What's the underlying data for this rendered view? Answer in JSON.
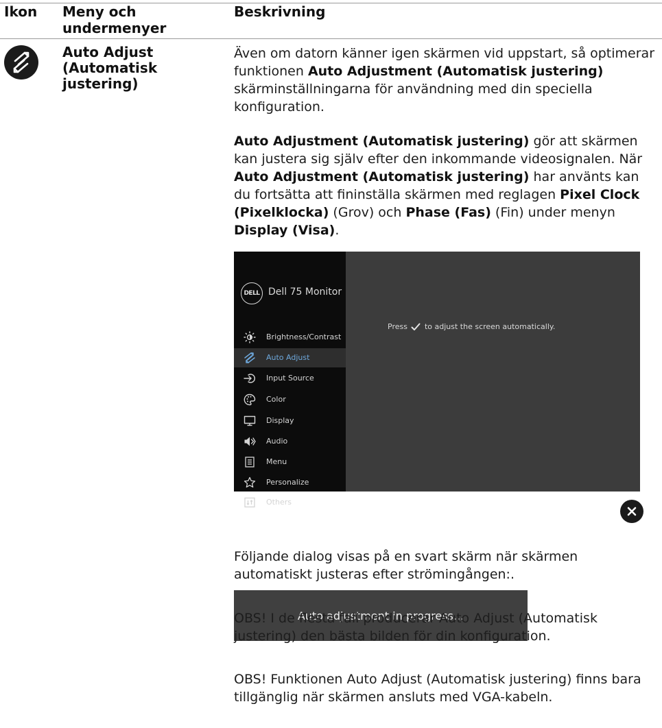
{
  "table": {
    "headers": {
      "icon": "Ikon",
      "menu": "Meny och undermenyer",
      "description": "Beskrivning"
    },
    "row": {
      "icon_name": "auto-adjust-icon",
      "menu_title": "Auto Adjust (Automatisk justering)",
      "paragraph1": {
        "pre": "Även om datorn känner igen skärmen vid uppstart, så optimerar funktionen ",
        "bold": "Auto Adjustment (Automatisk justering)",
        "post": " skärminställningarna för användning med din speciella konfiguration."
      },
      "paragraph2": {
        "b1": "Auto Adjustment (Automatisk justering)",
        "t1": " gör att skärmen kan justera sig själv efter den inkommande videosignalen. När ",
        "b2": "Auto Adjustment (Automatisk justering)",
        "t2": " har använts kan du fortsätta att fininställa skärmen med reglagen ",
        "b3": "Pixel Clock (Pixelklocka)",
        "t3": " (Grov) och ",
        "b4": "Phase (Fas)",
        "t4": " (Fin) under menyn ",
        "b5": "Display (Visa)",
        "t5": "."
      },
      "paragraph3": "Följande dialog visas på en svart skärm när skärmen automatiskt justeras efter strömingången:.",
      "note1": "OBS! I de flesta fall producerar Auto Adjust (Automatisk justering) den bästa bilden för din konfiguration.",
      "note2": "OBS! Funktionen Auto Adjust (Automatisk justering) finns bara tillgänglig när skärmen ansluts med VGA-kabeln."
    }
  },
  "osd": {
    "logo": "DELL",
    "title": "Dell 75 Monitor",
    "active_item": "Auto Adjust",
    "active_color": "#6ea8dc",
    "items": [
      {
        "label": "Brightness/Contrast",
        "icon": "brightness-icon"
      },
      {
        "label": "Auto Adjust",
        "icon": "auto-adjust-icon"
      },
      {
        "label": "Input Source",
        "icon": "input-source-icon"
      },
      {
        "label": "Color",
        "icon": "color-palette-icon"
      },
      {
        "label": "Display",
        "icon": "display-icon"
      },
      {
        "label": "Audio",
        "icon": "speaker-icon"
      },
      {
        "label": "Menu",
        "icon": "menu-icon"
      },
      {
        "label": "Personalize",
        "icon": "star-icon"
      },
      {
        "label": "Others",
        "icon": "others-icon"
      }
    ],
    "message_pre": "Press",
    "message_icon": "checkmark-icon",
    "message_post": "to adjust the screen automatically."
  },
  "close_icon": "close-icon",
  "dialog": {
    "text": "Auto adjustment in progress..."
  }
}
